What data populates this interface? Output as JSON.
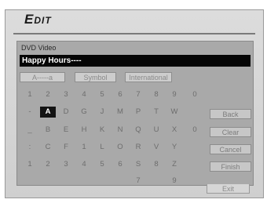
{
  "header": {
    "title": "Edit"
  },
  "panel": {
    "label": "DVD Video",
    "name_value": "Happy Hours----"
  },
  "modes": [
    "A-----a",
    "Symbol",
    "International"
  ],
  "grid": {
    "rows": [
      [
        "1",
        "2",
        "3",
        "4",
        "5",
        "6",
        "7",
        "8",
        "9",
        "0"
      ],
      [
        "-",
        "A",
        "D",
        "G",
        "J",
        "M",
        "P",
        "T",
        "W",
        ""
      ],
      [
        "_",
        "B",
        "E",
        "H",
        "K",
        "N",
        "Q",
        "U",
        "X",
        "0"
      ],
      [
        ":",
        "C",
        "F",
        "1",
        "L",
        "O",
        "R",
        "V",
        "Y",
        ""
      ],
      [
        "1",
        "2",
        "3",
        "4",
        "5",
        "6",
        "S",
        "8",
        "Z",
        ""
      ],
      [
        "",
        "",
        "",
        "",
        "",
        "",
        "7",
        "",
        "9",
        ""
      ]
    ],
    "selected": "A"
  },
  "actions": {
    "back": "Back",
    "clear": "Clear",
    "cancel": "Cancel",
    "finish": "Finish"
  },
  "footer": {
    "exit": "Exit"
  }
}
